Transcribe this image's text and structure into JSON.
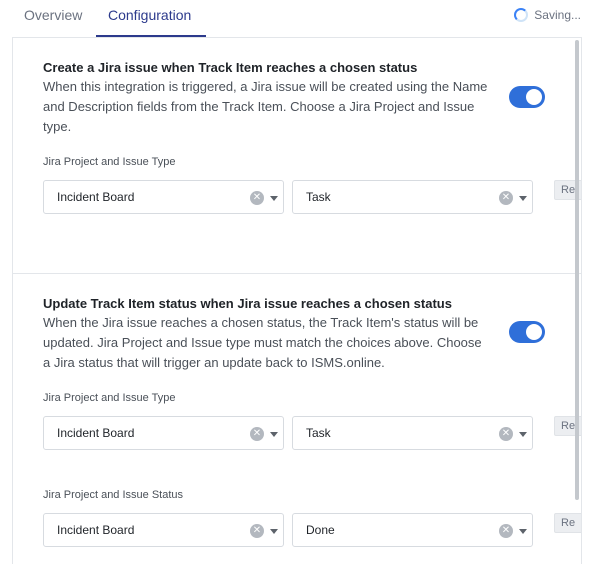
{
  "tabs": [
    {
      "label": "Overview"
    },
    {
      "label": "Configuration"
    }
  ],
  "status": {
    "saving_label": "Saving..."
  },
  "section1": {
    "title": "Create a Jira issue when Track Item reaches a chosen status",
    "description": "When this integration is triggered, a Jira issue will be created using the Name and Description fields from the Track Item. Choose a Jira Project and Issue type.",
    "toggle_on": true,
    "field_label": "Jira Project and Issue Type",
    "project_value": "Incident Board",
    "type_value": "Task",
    "side_button_label": "Re"
  },
  "section2": {
    "title": "Update Track Item status when Jira issue reaches a chosen status",
    "description": "When the Jira issue reaches a chosen status, the Track Item's status will be updated. Jira Project and Issue type must match the choices above. Choose a Jira status that will trigger an update back to ISMS.online.",
    "toggle_on": true,
    "field_label_type": "Jira Project and Issue Type",
    "project_value": "Incident Board",
    "type_value": "Task",
    "field_label_status": "Jira Project and Issue Status",
    "status_project_value": "Incident Board",
    "status_value": "Done",
    "side_button_label": "Re"
  },
  "icons": {
    "clear": "clear-icon",
    "chevron": "chevron-down-icon",
    "spinner": "spinner-icon"
  },
  "colors": {
    "accent": "#2c3a8c",
    "toggle": "#2f6fd9"
  }
}
